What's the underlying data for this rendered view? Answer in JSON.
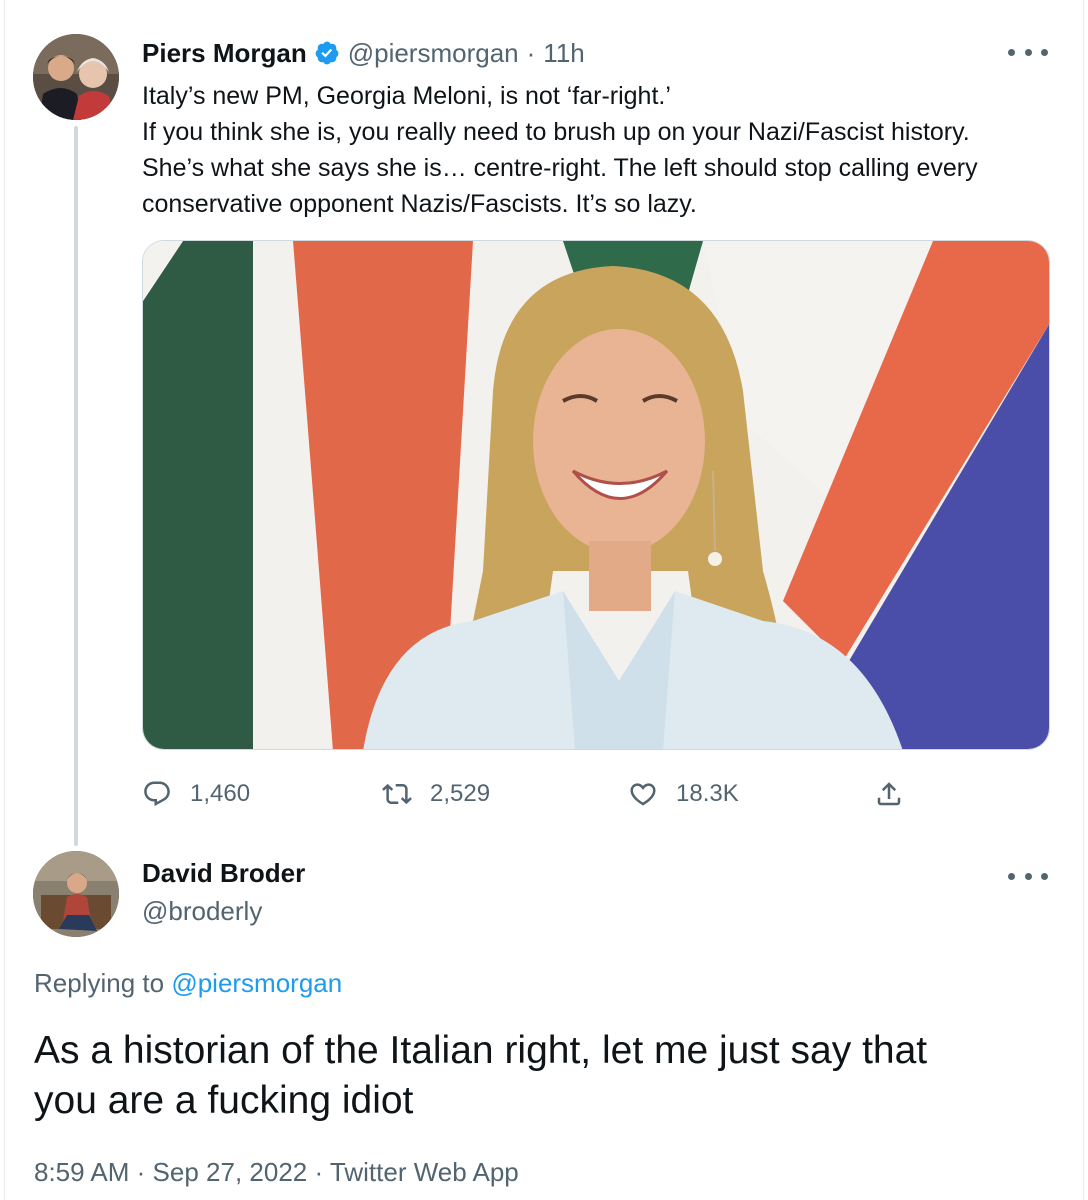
{
  "parent_tweet": {
    "author_name": "Piers Morgan",
    "handle": "@piersmorgan",
    "separator": "·",
    "time_ago": "11h",
    "text_lines": [
      "Italy’s new PM, Georgia Meloni, is not ‘far-right.’",
      "If you think she is, you really need to brush up on your Nazi/Fascist history.",
      "She’s what she says she is… centre-right. The left should stop calling every",
      "conservative opponent Nazis/Fascists. It’s so lazy."
    ],
    "stats": {
      "replies": "1,460",
      "retweets": "2,529",
      "likes": "18.3K"
    }
  },
  "reply_tweet": {
    "author_name": "David Broder",
    "handle": "@broderly",
    "replying_prefix": "Replying to",
    "replying_to": "@piersmorgan",
    "text_lines": [
      "As a historian of the Italian right, let me just say that",
      "you are a fucking idiot"
    ],
    "time": "8:59 AM",
    "date": "Sep 27, 2022",
    "source": "Twitter Web App",
    "separator": "·"
  },
  "colors": {
    "text_primary": "#0f1419",
    "text_secondary": "#536471",
    "link": "#1d9bf0",
    "verified_badge": "#1d9bf0",
    "thread_line": "#cfd9de"
  },
  "icons": {
    "reply": "speech-bubble-icon",
    "retweet": "retweet-arrows-icon",
    "like": "heart-icon",
    "share": "share-upload-icon",
    "more": "more-horizontal-icon",
    "verified": "verified-badge-icon"
  }
}
